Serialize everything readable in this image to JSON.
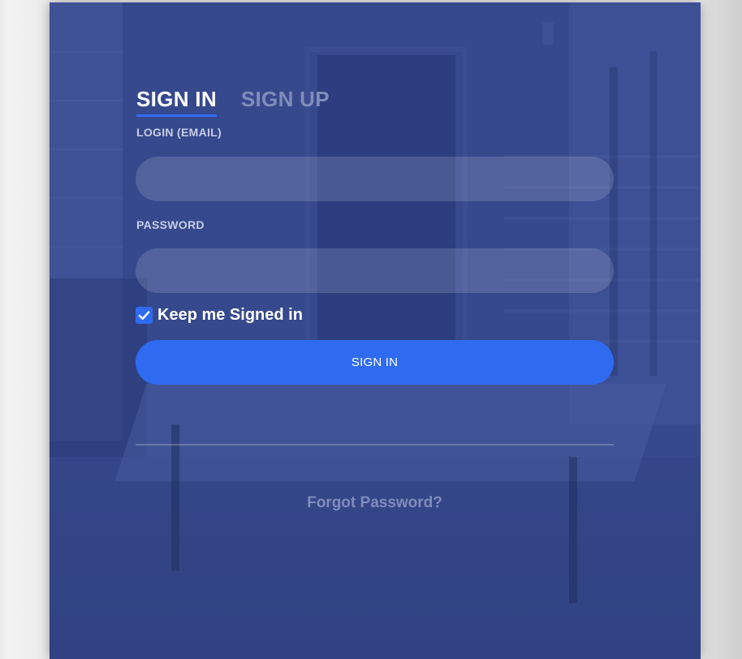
{
  "tabs": {
    "sign_in": "SIGN IN",
    "sign_up": "SIGN UP"
  },
  "form": {
    "email_label": "LOGIN (EMAIL)",
    "email_value": "",
    "password_label": "PASSWORD",
    "password_value": "",
    "keep_signed_in_label": "Keep me Signed in",
    "keep_signed_in_checked": true,
    "submit_label": "SIGN IN",
    "forgot_password_link": "Forgot Password?"
  },
  "colors": {
    "accent": "#2f6bf0",
    "panel_overlay": "#3d4f8e",
    "inactive_text": "#7f8dbc"
  },
  "icons": {
    "checkbox": "checkmark-icon"
  }
}
